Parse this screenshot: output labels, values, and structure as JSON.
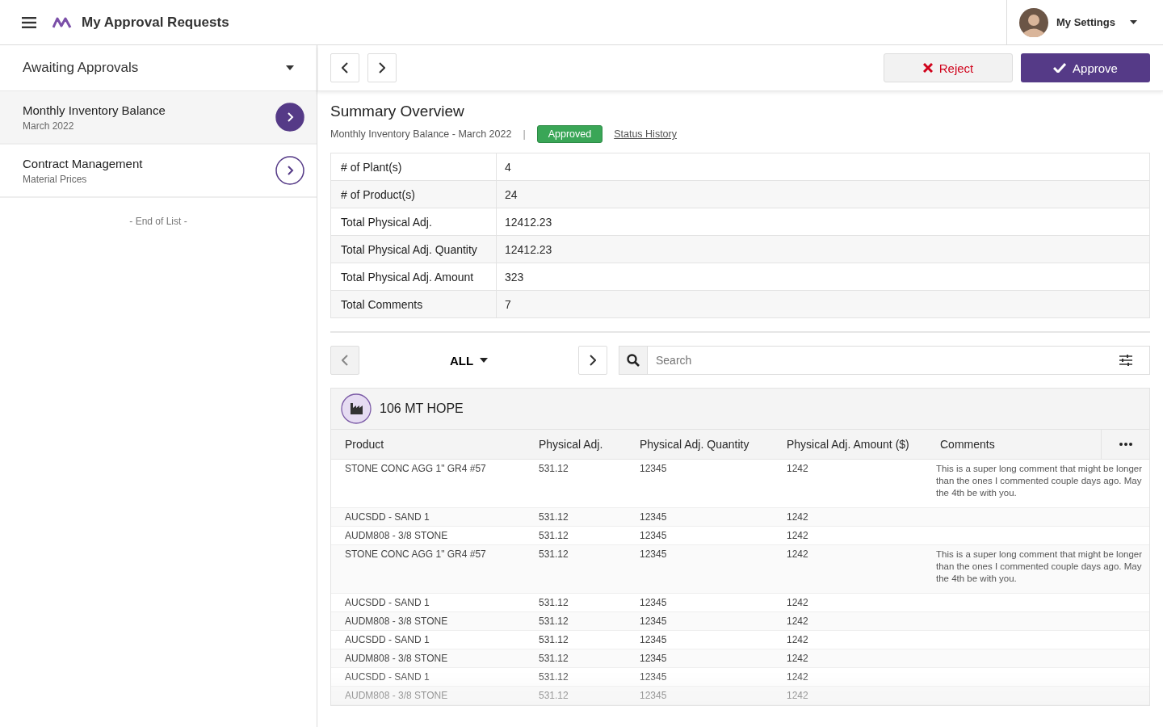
{
  "header": {
    "title": "My Approval Requests",
    "settings_label": "My Settings"
  },
  "sidebar": {
    "filter": "Awaiting Approvals",
    "items": [
      {
        "title": "Monthly Inventory Balance",
        "subtitle": "March 2022",
        "selected": true
      },
      {
        "title": "Contract Management",
        "subtitle": "Material Prices",
        "selected": false
      }
    ],
    "end_note": "- End of List -"
  },
  "toolbar": {
    "reject": "Reject",
    "approve": "Approve"
  },
  "summary": {
    "title": "Summary Overview",
    "subtitle": "Monthly Inventory Balance - March 2022",
    "separator": "|",
    "status": "Approved",
    "history_link": "Status History",
    "rows": [
      {
        "label": "# of Plant(s)",
        "value": "4"
      },
      {
        "label": "# of Product(s)",
        "value": "24"
      },
      {
        "label": "Total Physical Adj.",
        "value": "12412.23"
      },
      {
        "label": "Total Physical Adj. Quantity",
        "value": "12412.23"
      },
      {
        "label": "Total Physical Adj. Amount",
        "value": "323"
      },
      {
        "label": "Total Comments",
        "value": "7"
      }
    ]
  },
  "filter_bar": {
    "scope": "ALL",
    "search_placeholder": "Search"
  },
  "plant": {
    "name": "106 MT HOPE",
    "columns": [
      "Product",
      "Physical Adj.",
      "Physical Adj. Quantity",
      "Physical Adj. Amount ($)",
      "Comments"
    ],
    "rows": [
      [
        "STONE CONC AGG 1\" GR4 #57",
        "531.12",
        "12345",
        "1242",
        "This is a super long comment that might be longer than the ones I commented couple days ago. May the 4th be with you."
      ],
      [
        "AUCSDD - SAND 1",
        "531.12",
        "12345",
        "1242",
        ""
      ],
      [
        "AUDM808 - 3/8 STONE",
        "531.12",
        "12345",
        "1242",
        ""
      ],
      [
        "STONE CONC AGG 1\" GR4 #57",
        "531.12",
        "12345",
        "1242",
        "This is a super long comment that might be longer than the ones I commented couple days ago. May the 4th be with you."
      ],
      [
        "AUCSDD - SAND 1",
        "531.12",
        "12345",
        "1242",
        ""
      ],
      [
        "AUDM808 - 3/8 STONE",
        "531.12",
        "12345",
        "1242",
        ""
      ],
      [
        "AUCSDD - SAND 1",
        "531.12",
        "12345",
        "1242",
        ""
      ],
      [
        "AUDM808 - 3/8 STONE",
        "531.12",
        "12345",
        "1242",
        ""
      ],
      [
        "AUCSDD - SAND 1",
        "531.12",
        "12345",
        "1242",
        ""
      ],
      [
        "AUDM808 - 3/8 STONE",
        "531.12",
        "12345",
        "1242",
        ""
      ]
    ]
  }
}
